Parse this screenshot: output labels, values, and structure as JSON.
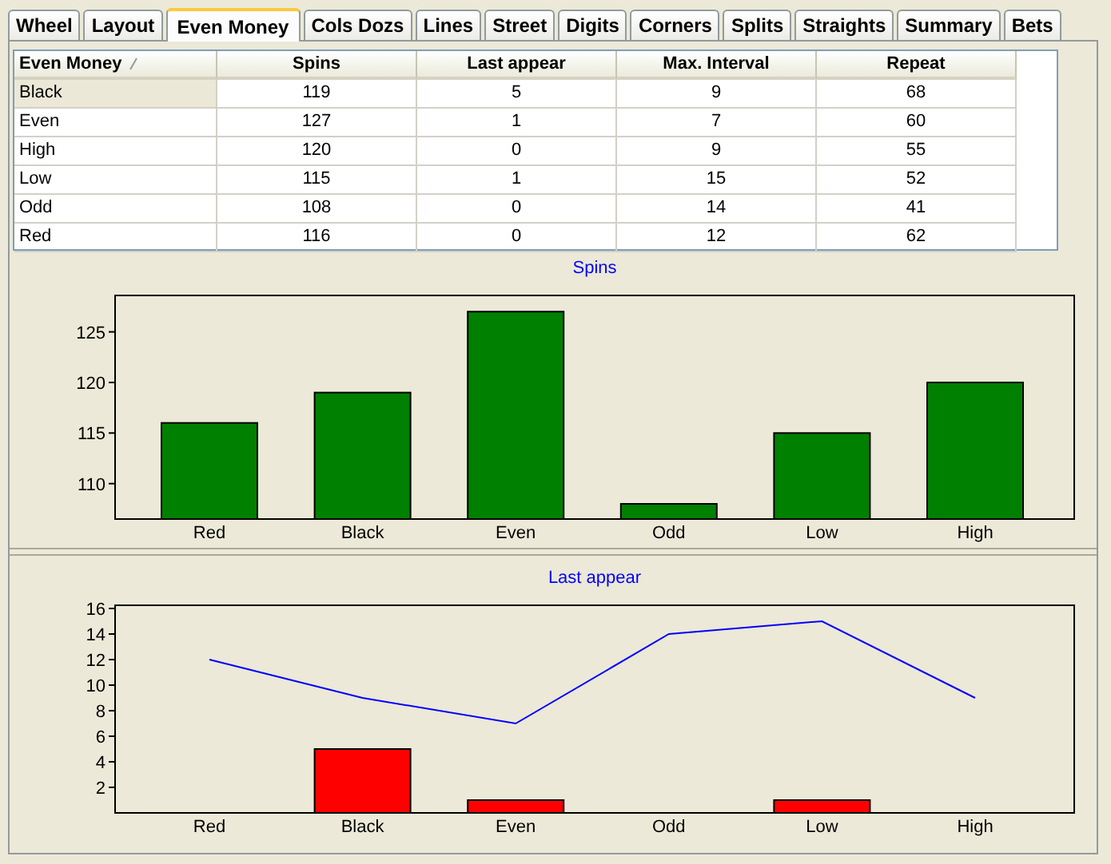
{
  "tabs": [
    {
      "label": "Wheel",
      "selected": false
    },
    {
      "label": "Layout",
      "selected": false
    },
    {
      "label": "Even Money",
      "selected": true
    },
    {
      "label": "Cols Dozs",
      "selected": false
    },
    {
      "label": "Lines",
      "selected": false
    },
    {
      "label": "Street",
      "selected": false
    },
    {
      "label": "Digits",
      "selected": false
    },
    {
      "label": "Corners",
      "selected": false
    },
    {
      "label": "Splits",
      "selected": false
    },
    {
      "label": "Straights",
      "selected": false
    },
    {
      "label": "Summary",
      "selected": false
    },
    {
      "label": "Bets",
      "selected": false
    }
  ],
  "table": {
    "columns": [
      "Even Money",
      "Spins",
      "Last appear",
      "Max. Interval",
      "Repeat"
    ],
    "rows": [
      {
        "cells": [
          "Black",
          "119",
          "5",
          "9",
          "68"
        ],
        "selected": true
      },
      {
        "cells": [
          "Even",
          "127",
          "1",
          "7",
          "60"
        ],
        "selected": false
      },
      {
        "cells": [
          "High",
          "120",
          "0",
          "9",
          "55"
        ],
        "selected": false
      },
      {
        "cells": [
          "Low",
          "115",
          "1",
          "15",
          "52"
        ],
        "selected": false
      },
      {
        "cells": [
          "Odd",
          "108",
          "0",
          "14",
          "41"
        ],
        "selected": false
      },
      {
        "cells": [
          "Red",
          "116",
          "0",
          "12",
          "62"
        ],
        "selected": false
      }
    ]
  },
  "charts": [
    {
      "chart_data": {
        "type": "bar",
        "title": "Spins",
        "categories": [
          "Red",
          "Black",
          "Even",
          "Odd",
          "Low",
          "High"
        ],
        "ylim": [
          106.5,
          128.6
        ],
        "yticks": [
          110,
          115,
          120,
          125
        ],
        "series": [
          {
            "color": "#008000",
            "values": [
              116,
              119,
              127,
              108,
              115,
              120
            ]
          }
        ]
      }
    },
    {
      "chart_data": {
        "type": "bar",
        "title": "Last appear",
        "categories": [
          "Red",
          "Black",
          "Even",
          "Odd",
          "Low",
          "High"
        ],
        "ylim": [
          0,
          16.25
        ],
        "yticks": [
          2,
          4,
          6,
          8,
          10,
          12,
          14,
          16
        ],
        "series": [
          {
            "color": "#ff0000",
            "values": [
              0,
              5,
              1,
              0,
              1,
              0
            ]
          },
          {
            "type": "line",
            "color": "#0000ff",
            "values": [
              12,
              9,
              7,
              14,
              15,
              9
            ]
          }
        ]
      }
    }
  ]
}
